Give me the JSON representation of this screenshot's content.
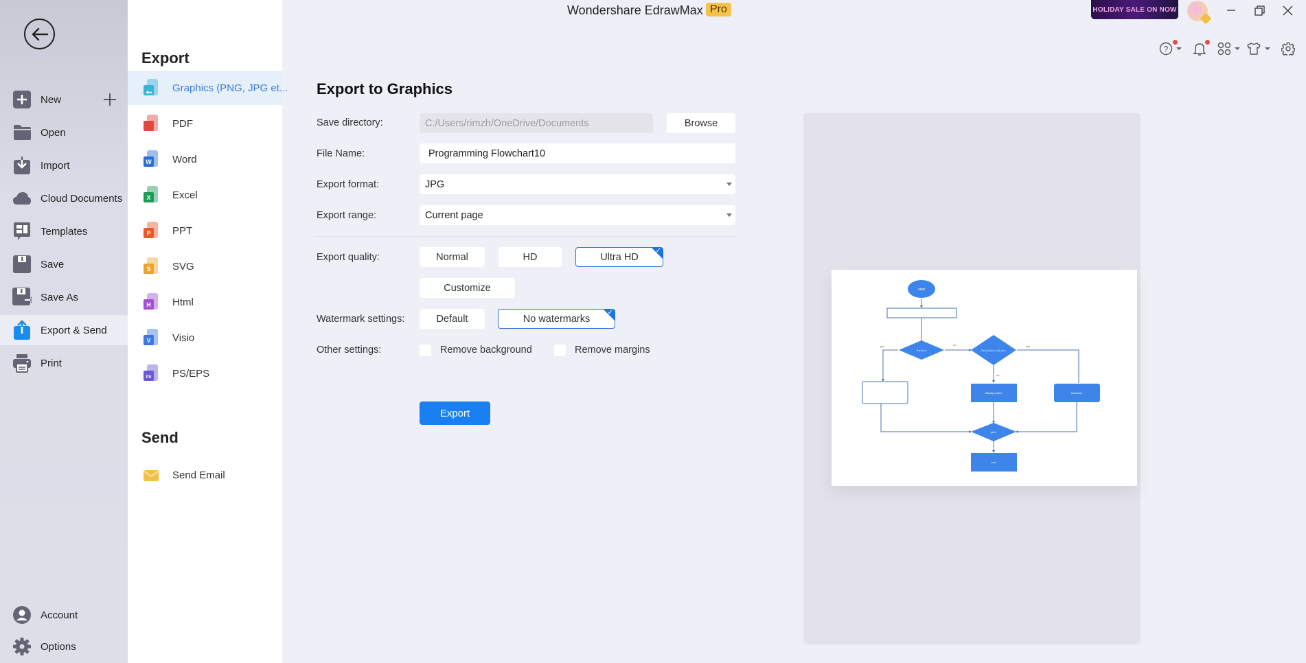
{
  "window": {
    "app_title": "Wondershare EdrawMax",
    "badge": "Pro",
    "promo": "HOLIDAY SALE ON NOW",
    "controls": [
      "minimize",
      "restore",
      "close"
    ]
  },
  "toolbar": {
    "icons": [
      "help-icon",
      "bell-icon",
      "apps-icon",
      "shirt-icon",
      "gear-icon"
    ]
  },
  "rail": {
    "items": [
      {
        "label": "New",
        "icon": "new-icon"
      },
      {
        "label": "Open",
        "icon": "folder-icon"
      },
      {
        "label": "Import",
        "icon": "import-icon"
      },
      {
        "label": "Cloud Documents",
        "icon": "cloud-icon"
      },
      {
        "label": "Templates",
        "icon": "templates-icon"
      },
      {
        "label": "Save",
        "icon": "save-icon"
      },
      {
        "label": "Save As",
        "icon": "save-as-icon"
      },
      {
        "label": "Export & Send",
        "icon": "export-icon",
        "active": true
      },
      {
        "label": "Print",
        "icon": "print-icon"
      }
    ],
    "bottom": [
      {
        "label": "Account",
        "icon": "account-icon"
      },
      {
        "label": "Options",
        "icon": "options-gear-icon"
      }
    ]
  },
  "export_list": {
    "heading": "Export",
    "items": [
      {
        "label": "Graphics (PNG, JPG et...",
        "color": "#3bb3d8",
        "active": true
      },
      {
        "label": "PDF",
        "color": "#e2483d",
        "letter": ""
      },
      {
        "label": "Word",
        "color": "#2b6fd6",
        "letter": "W"
      },
      {
        "label": "Excel",
        "color": "#1f9a55",
        "letter": "X"
      },
      {
        "label": "PPT",
        "color": "#e85a2c",
        "letter": "P"
      },
      {
        "label": "SVG",
        "color": "#eaa62c",
        "letter": "S"
      },
      {
        "label": "Html",
        "color": "#a24fd6",
        "letter": "H"
      },
      {
        "label": "Visio",
        "color": "#3a78e0",
        "letter": "V"
      },
      {
        "label": "PS/EPS",
        "color": "#6a58d6",
        "letter": "PS"
      }
    ],
    "send_heading": "Send",
    "send_items": [
      {
        "label": "Send Email",
        "color": "#f5c04a"
      }
    ]
  },
  "form": {
    "title": "Export to Graphics",
    "save_directory": {
      "label": "Save directory:",
      "value": "C:/Users/rimzh/OneDrive/Documents",
      "browse": "Browse"
    },
    "file_name": {
      "label": "File Name:",
      "value": "Programming Flowchart10"
    },
    "export_format": {
      "label": "Export format:",
      "value": "JPG"
    },
    "export_range": {
      "label": "Export range:",
      "value": "Current page"
    },
    "export_quality": {
      "label": "Export quality:",
      "options": [
        "Normal",
        "HD",
        "Ultra HD"
      ],
      "selected": "Ultra HD",
      "customize": "Customize"
    },
    "watermark": {
      "label": "Watermark settings:",
      "options": [
        "Default",
        "No watermarks"
      ],
      "selected": "No watermarks"
    },
    "other": {
      "label": "Other settings:",
      "remove_background": "Remove background",
      "remove_margins": "Remove margins",
      "remove_background_checked": false,
      "remove_margins_checked": false
    },
    "export_button": "Export"
  },
  "preview": {
    "flowchart": {
      "start": "start",
      "decision1": "if a>b>c",
      "decision2": "if a==b || b==c && a!=c",
      "box_left": "",
      "box_mid": "display scalen",
      "box_right": "isosceles",
      "merge": "print",
      "end": "end",
      "yes1": "yes",
      "no1": "no",
      "yes2": "yes",
      "no2": "no"
    }
  }
}
